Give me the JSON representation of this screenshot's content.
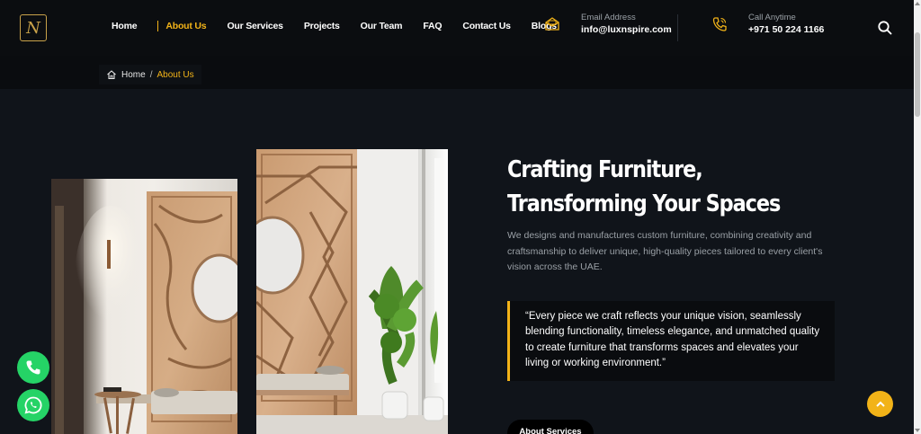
{
  "header": {
    "logo_letter": "N",
    "nav": [
      {
        "label": "Home",
        "active": false
      },
      {
        "label": "About Us",
        "active": true
      },
      {
        "label": "Our Services",
        "active": false
      },
      {
        "label": "Projects",
        "active": false
      },
      {
        "label": "Our Team",
        "active": false
      },
      {
        "label": "FAQ",
        "active": false
      },
      {
        "label": "Contact Us",
        "active": false
      },
      {
        "label": "Blogs",
        "active": false
      }
    ],
    "email": {
      "label": "Email Address",
      "value": "info@luxnspire.com",
      "icon": "email-icon"
    },
    "phone": {
      "label": "Call Anytime",
      "value": "+971 50 224 1166",
      "icon": "phone-icon"
    },
    "search_icon": "search-icon"
  },
  "breadcrumb": {
    "home": "Home",
    "separator": "/",
    "current": "About Us"
  },
  "main": {
    "title": "Crafting Furniture, Transforming Your Spaces",
    "description": "We designs and manufactures custom furniture, combining creativity and craftsmanship to deliver unique, high-quality pieces tailored to every client's vision across the UAE.",
    "quote": "“Every piece we craft reflects your unique vision, seamlessly blending functionality, timeless elegance, and unmatched quality to create furniture that transforms spaces and elevates your living or working environment.”",
    "button_label": "About Services"
  },
  "colors": {
    "accent": "#f2b318",
    "background": "#10141a",
    "whatsapp": "#25d366"
  }
}
